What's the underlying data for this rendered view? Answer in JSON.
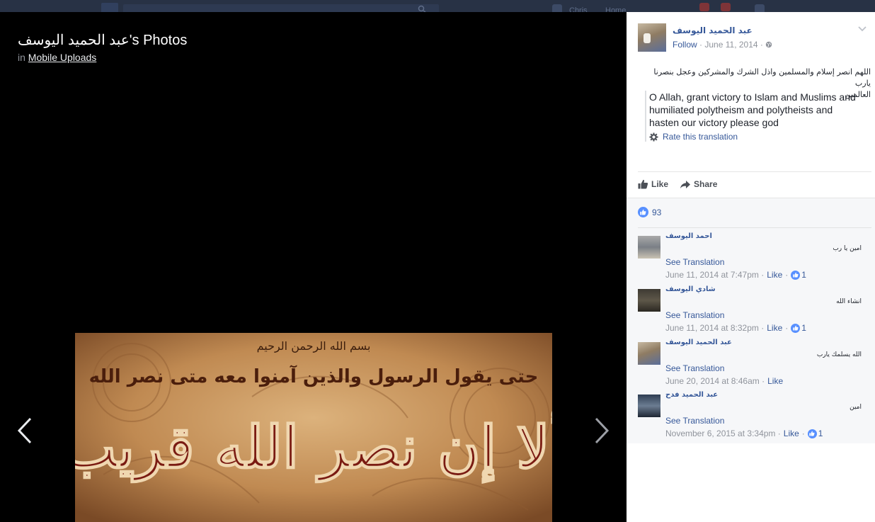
{
  "topbar": {
    "nav_user": "Chris",
    "nav_home": "Home"
  },
  "stage": {
    "title": "عبد الحميد اليوسف's Photos",
    "album_prefix": "in",
    "album_link": "Mobile Uploads",
    "photo": {
      "basmala": "بسم الله الرحمن الرحيم",
      "verse_line": "حتى يقول الرسول والذين آمنوا معه متى نصر الله",
      "main_calligraphy": "ألا إن نصر الله قريب"
    }
  },
  "post": {
    "author": "عبد الحميد اليوسف",
    "follow": "Follow",
    "date": "June 11, 2014",
    "separator": "·",
    "text_line1": "اللهم انصر إسلام والمسلمين واذل الشرك والمشركين وعجل بنصرنا يارب",
    "text_line2": "العالمين",
    "translation": "O Allah, grant victory to Islam and Muslims and humiliated polytheism and polytheists and hasten our victory please god",
    "rate_translation": "Rate this translation",
    "like_label": "Like",
    "share_label": "Share",
    "like_count": "93"
  },
  "comments": [
    {
      "name": "احمد اليوسف",
      "text": "امين يا رب",
      "see_translation": "See Translation",
      "timestamp": "June 11, 2014 at 7:47pm",
      "like": "Like",
      "likes": "1"
    },
    {
      "name": "شادي اليوسف",
      "text": "انشاء الله",
      "see_translation": "See Translation",
      "timestamp": "June 11, 2014 at 8:32pm",
      "like": "Like",
      "likes": "1"
    },
    {
      "name": "عبد الحميد اليوسف",
      "text": "الله يسلمك يارب",
      "see_translation": "See Translation",
      "timestamp": "June 20, 2014 at 8:46am",
      "like": "Like",
      "likes": ""
    },
    {
      "name": "عبد الحميد فدح",
      "text": "امين",
      "see_translation": "See Translation",
      "timestamp": "November 6, 2015 at 3:34pm",
      "like": "Like",
      "likes": "1"
    }
  ],
  "colors": {
    "link": "#365899",
    "like_blue": "#5890ff",
    "stage_bg": "#000000",
    "panel_bg": "#ffffff",
    "comments_bg": "#f6f7f9"
  },
  "icons": {
    "prev": "chevron-left-icon",
    "next": "chevron-right-icon",
    "globe": "globe-icon",
    "gear": "gear-icon",
    "like": "thumbs-up-icon",
    "share": "share-arrow-icon",
    "options": "chevron-down-icon"
  }
}
